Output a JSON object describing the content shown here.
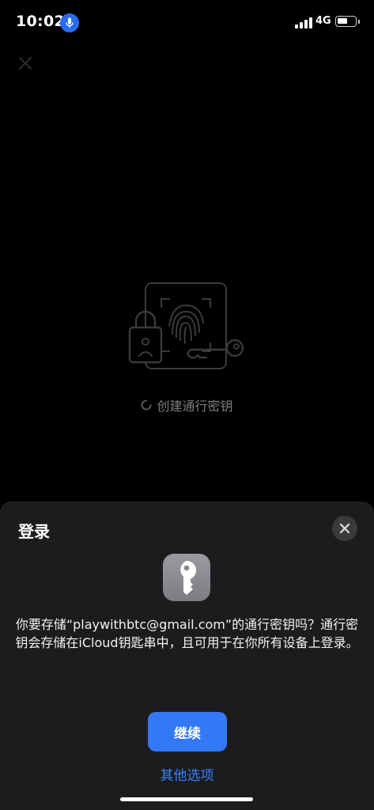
{
  "status_bar": {
    "time": "10:02",
    "network": "4G"
  },
  "background": {
    "creating_label": "创建通行密钥"
  },
  "sheet": {
    "title": "登录",
    "message": "你要存储“playwithbtc@gmail.com”的通行密钥吗？通行密钥会存储在iCloud钥匙串中，且可用于在你所有设备上登录。",
    "continue_label": "继续",
    "other_options_label": "其他选项"
  },
  "colors": {
    "accent": "#3478f6",
    "sheet_background": "#1c1c1e",
    "mic_indicator": "#2a6cf0"
  }
}
